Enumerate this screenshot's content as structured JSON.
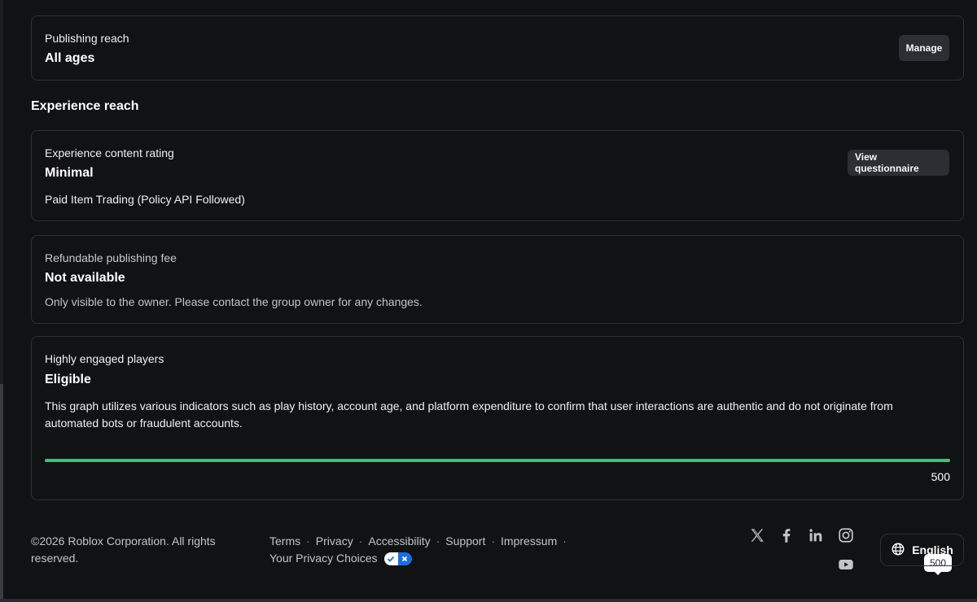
{
  "publishing": {
    "label": "Publishing reach",
    "value": "All ages",
    "manage_label": "Manage"
  },
  "experience_reach": {
    "heading": "Experience reach",
    "content_rating": {
      "label": "Experience content rating",
      "value": "Minimal",
      "detail": "Paid Item Trading (Policy API Followed)",
      "button_label": "View questionnaire"
    },
    "publishing_fee": {
      "label": "Refundable publishing fee",
      "value": "Not available",
      "detail": "Only visible to the owner. Please contact the group owner for any changes."
    },
    "engaged_players": {
      "label": "Highly engaged players",
      "value": "Eligible",
      "description": "This graph utilizes various indicators such as play history, account age, and platform expenditure to confirm that user interactions are authentic and do not originate from automated bots or fraudulent accounts.",
      "slider_tooltip": "500",
      "slider_value": "500",
      "slider_fraction": 1.0,
      "slider_color": "#3fbf7f"
    }
  },
  "footer": {
    "copyright": "©2026 Roblox Corporation. All rights reserved.",
    "links_row1": [
      "Terms",
      "Privacy",
      "Accessibility",
      "Support",
      "Impressum"
    ],
    "privacy_choices": "Your Privacy Choices",
    "separator": "·",
    "social_icons": [
      "x-icon",
      "facebook-icon",
      "linkedin-icon",
      "instagram-icon",
      "youtube-icon"
    ],
    "language": "English"
  },
  "colors": {
    "background": "#111214",
    "card_border": "#2e3035",
    "button_bg": "#2c2e33",
    "accent_green": "#3fbf7f",
    "privacy_blue": "#1a6de0"
  }
}
